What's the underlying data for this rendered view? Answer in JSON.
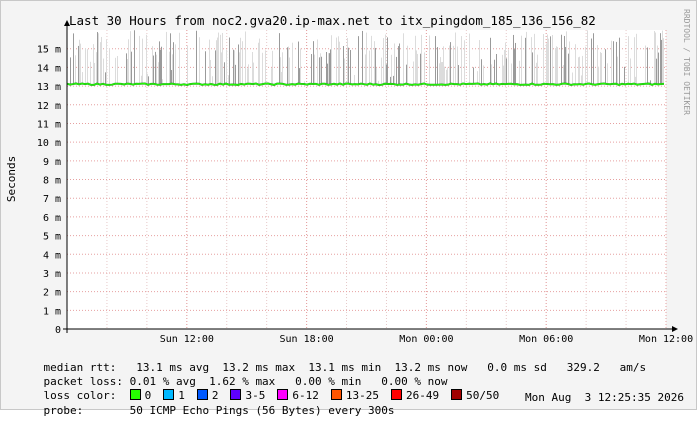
{
  "chart_data": {
    "type": "line",
    "title": "Last 30 Hours from noc2.gva20.ip-max.net to itx_pingdom_185_136_156_82",
    "ylabel": "Seconds",
    "xlabel": "",
    "y_unit": "m",
    "ylim": [
      0,
      16
    ],
    "y_ticks": [
      {
        "v": 0,
        "label": "0"
      },
      {
        "v": 1,
        "label": "1 m"
      },
      {
        "v": 2,
        "label": "2 m"
      },
      {
        "v": 3,
        "label": "3 m"
      },
      {
        "v": 4,
        "label": "4 m"
      },
      {
        "v": 5,
        "label": "5 m"
      },
      {
        "v": 6,
        "label": "6 m"
      },
      {
        "v": 7,
        "label": "7 m"
      },
      {
        "v": 8,
        "label": "8 m"
      },
      {
        "v": 9,
        "label": "9 m"
      },
      {
        "v": 10,
        "label": "10 m"
      },
      {
        "v": 11,
        "label": "11 m"
      },
      {
        "v": 12,
        "label": "12 m"
      },
      {
        "v": 13,
        "label": "13 m"
      },
      {
        "v": 14,
        "label": "14 m"
      },
      {
        "v": 15,
        "label": "15 m"
      }
    ],
    "xlim_hours": [
      0,
      30
    ],
    "x_ticks": [
      {
        "h": 6,
        "label": "Sun 12:00"
      },
      {
        "h": 12,
        "label": "Sun 18:00"
      },
      {
        "h": 18,
        "label": "Mon 00:00"
      },
      {
        "h": 24,
        "label": "Mon 06:00"
      },
      {
        "h": 30,
        "label": "Mon 12:00"
      }
    ],
    "median_rtt_ms": 13.1,
    "smoke_band_ms": [
      13.0,
      16.0
    ],
    "grid": true,
    "watermark": "RRDTOOL / TOBI OETIKER"
  },
  "stats": {
    "median_label": "median rtt:",
    "median_values": "13.1 ms avg  13.2 ms max  13.1 ms min  13.2 ms now   0.0 ms sd   329.2   am/s",
    "loss_label": "packet loss:",
    "loss_values": "0.01 % avg  1.62 % max   0.00 % min   0.00 % now",
    "color_label": "loss color:",
    "loss_colors": [
      {
        "label": "0",
        "color": "#26ff00"
      },
      {
        "label": "1",
        "color": "#00b8ff"
      },
      {
        "label": "2",
        "color": "#0059ff"
      },
      {
        "label": "3-5",
        "color": "#5e00ff"
      },
      {
        "label": "6-12",
        "color": "#ff00ff"
      },
      {
        "label": "13-25",
        "color": "#ff5500"
      },
      {
        "label": "26-49",
        "color": "#ff0000"
      },
      {
        "label": "50/50",
        "color": "#a10000"
      }
    ],
    "probe_label": "probe:",
    "probe_values": "50 ICMP Echo Pings (56 Bytes) every 300s",
    "timestamp": "Mon Aug  3 12:25:35 2026"
  }
}
